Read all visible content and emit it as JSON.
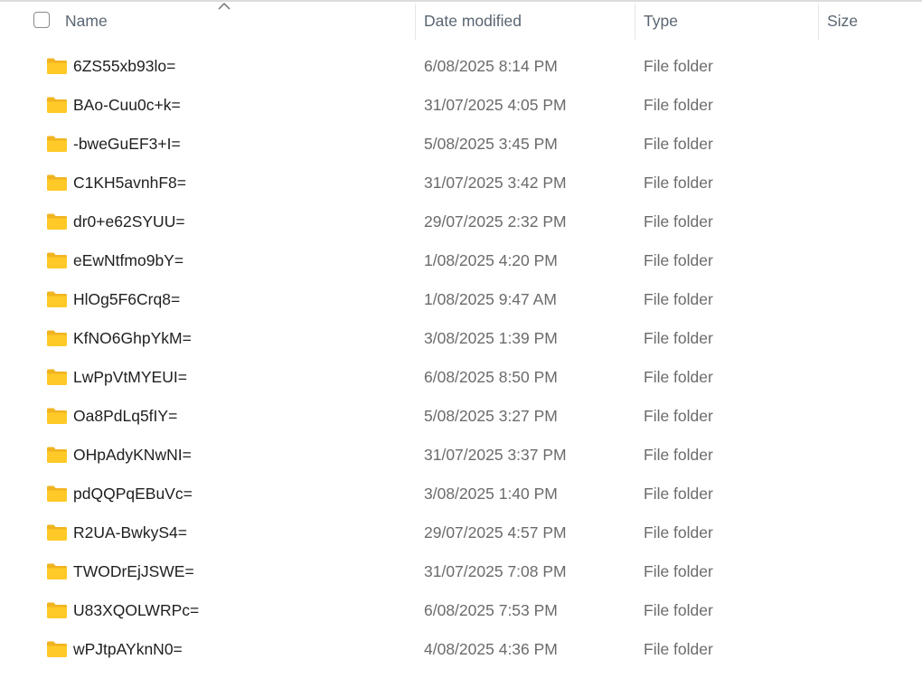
{
  "columns": {
    "name": "Name",
    "date_modified": "Date modified",
    "type": "Type",
    "size": "Size"
  },
  "sort": {
    "column": "Name",
    "direction": "ascending"
  },
  "icons": {
    "folder": "folder-icon",
    "sort": "chevron-up-icon",
    "select_all": "checkbox-icon"
  },
  "colors": {
    "folder_fill": "#FFCA28",
    "folder_tab": "#F0B421"
  },
  "rows": [
    {
      "name": "6ZS55xb93lo=",
      "date": "6/08/2025 8:14 PM",
      "type": "File folder"
    },
    {
      "name": "BAo-Cuu0c+k=",
      "date": "31/07/2025 4:05 PM",
      "type": "File folder"
    },
    {
      "name": "-bweGuEF3+I=",
      "date": "5/08/2025 3:45 PM",
      "type": "File folder"
    },
    {
      "name": "C1KH5avnhF8=",
      "date": "31/07/2025 3:42 PM",
      "type": "File folder"
    },
    {
      "name": "dr0+e62SYUU=",
      "date": "29/07/2025 2:32 PM",
      "type": "File folder"
    },
    {
      "name": "eEwNtfmo9bY=",
      "date": "1/08/2025 4:20 PM",
      "type": "File folder"
    },
    {
      "name": "HlOg5F6Crq8=",
      "date": "1/08/2025 9:47 AM",
      "type": "File folder"
    },
    {
      "name": "KfNO6GhpYkM=",
      "date": "3/08/2025 1:39 PM",
      "type": "File folder"
    },
    {
      "name": "LwPpVtMYEUI=",
      "date": "6/08/2025 8:50 PM",
      "type": "File folder"
    },
    {
      "name": "Oa8PdLq5fIY=",
      "date": "5/08/2025 3:27 PM",
      "type": "File folder"
    },
    {
      "name": "OHpAdyKNwNI=",
      "date": "31/07/2025 3:37 PM",
      "type": "File folder"
    },
    {
      "name": "pdQQPqEBuVc=",
      "date": "3/08/2025 1:40 PM",
      "type": "File folder"
    },
    {
      "name": "R2UA-BwkyS4=",
      "date": "29/07/2025 4:57 PM",
      "type": "File folder"
    },
    {
      "name": "TWODrEjJSWE=",
      "date": "31/07/2025 7:08 PM",
      "type": "File folder"
    },
    {
      "name": "U83XQOLWRPc=",
      "date": "6/08/2025 7:53 PM",
      "type": "File folder"
    },
    {
      "name": "wPJtpAYknN0=",
      "date": "4/08/2025 4:36 PM",
      "type": "File folder"
    }
  ]
}
